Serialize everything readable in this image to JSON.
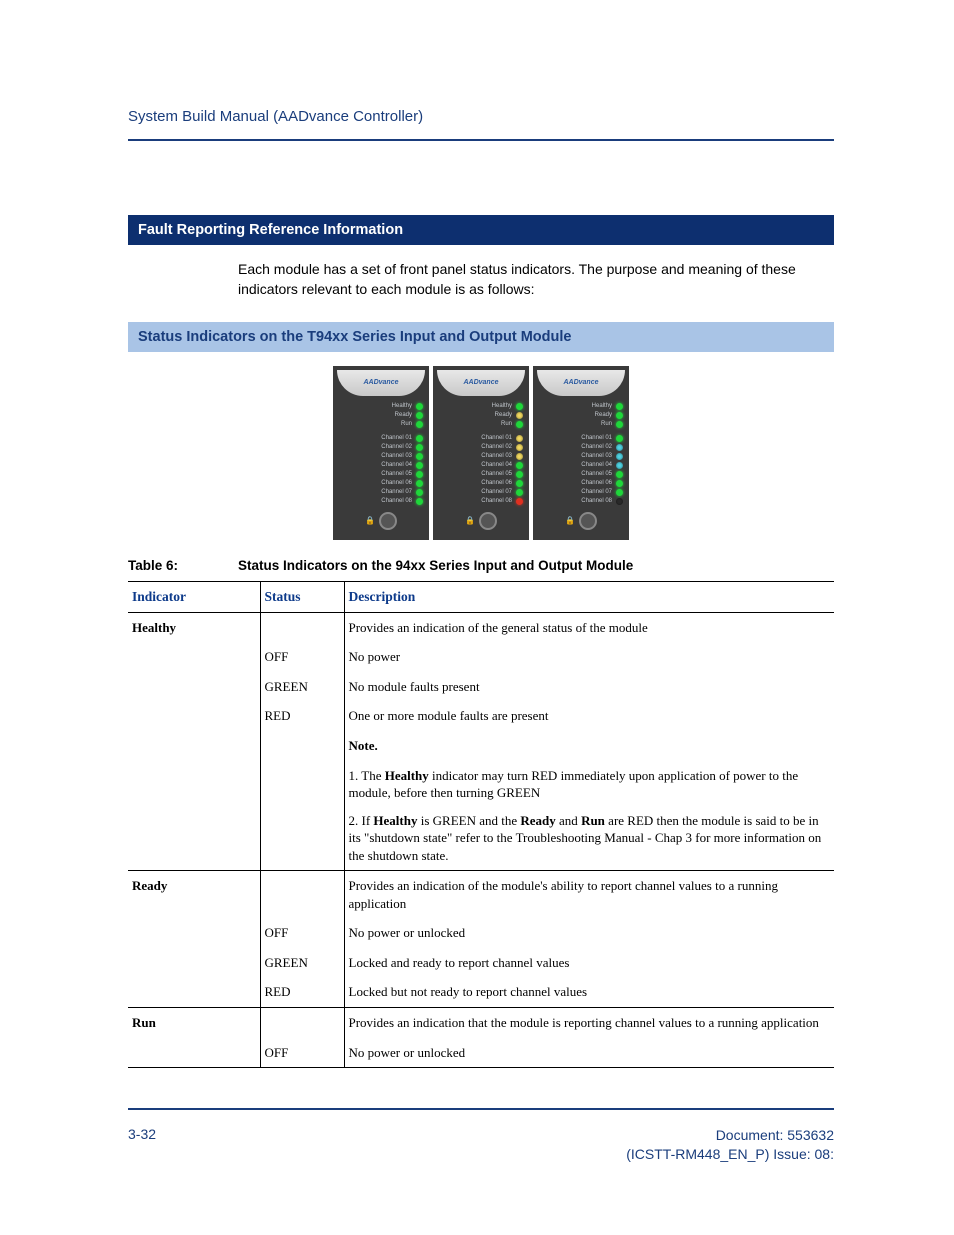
{
  "header": {
    "title": "System Build Manual  (AADvance Controller)"
  },
  "section1": {
    "title": "Fault Reporting Reference Information"
  },
  "intro": "Each module has a set of front panel status indicators. The purpose and meaning of these indicators relevant to each module is as follows:",
  "section2": {
    "title": "Status Indicators on the T94xx Series Input and Output Module"
  },
  "modules": {
    "brand": "AADvance",
    "status_labels": [
      "Healthy",
      "Ready",
      "Run"
    ],
    "channel_labels": [
      "Channel  01",
      "Channel  02",
      "Channel  03",
      "Channel  04",
      "Channel  05",
      "Channel  06",
      "Channel  07",
      "Channel  08"
    ],
    "units": [
      {
        "status_leds": [
          "green",
          "green",
          "green"
        ],
        "channel_leds": [
          "green",
          "green",
          "green",
          "green",
          "green",
          "green",
          "green",
          "green"
        ]
      },
      {
        "status_leds": [
          "green",
          "amber",
          "green"
        ],
        "channel_leds": [
          "amber",
          "amber",
          "amber",
          "green",
          "green",
          "green",
          "green",
          "red"
        ]
      },
      {
        "status_leds": [
          "green",
          "green",
          "green"
        ],
        "channel_leds": [
          "green",
          "cyan",
          "cyan",
          "cyan",
          "green",
          "green",
          "green",
          "dark"
        ]
      }
    ]
  },
  "table": {
    "caption_num": "Table 6:",
    "caption_text": "Status Indicators on the 94xx Series Input and Output Module",
    "headers": [
      "Indicator",
      "Status",
      "Description"
    ],
    "groups": [
      {
        "indicator": "Healthy",
        "heading_desc": "Provides an indication of the general status of the module",
        "rows": [
          {
            "status": "OFF",
            "desc": "No power"
          },
          {
            "status": "GREEN",
            "desc": "No module faults present"
          },
          {
            "status": "RED",
            "desc": "One or more module faults are present"
          }
        ],
        "note": {
          "title": "Note.",
          "p1_prefix": "1. The ",
          "p1_bold": "Healthy",
          "p1_suffix": " indicator may turn RED immediately upon application of power to the module, before then turning GREEN",
          "p2_prefix": " 2. If ",
          "p2_b1": "Healthy",
          "p2_mid1": " is GREEN and the ",
          "p2_b2": "Ready",
          "p2_mid2": " and ",
          "p2_b3": "Run",
          "p2_suffix": " are RED then the module is said to be in its \"shutdown state\" refer to the Troubleshooting Manual  - Chap 3 for more information on the shutdown state."
        }
      },
      {
        "indicator": "Ready",
        "heading_desc": "Provides an indication of the module's ability to report channel values to a running application",
        "rows": [
          {
            "status": "OFF",
            "desc": "No power or unlocked"
          },
          {
            "status": "GREEN",
            "desc": "Locked and ready to report channel values"
          },
          {
            "status": "RED",
            "desc": "Locked but not ready to report channel values"
          }
        ]
      },
      {
        "indicator": "Run",
        "heading_desc": "Provides an indication that the module is reporting channel values to a running application",
        "rows": [
          {
            "status": "OFF",
            "desc": "No power or unlocked"
          }
        ]
      }
    ]
  },
  "footer": {
    "page": "3-32",
    "doc_line1": "Document: 553632",
    "doc_line2": "(ICSTT-RM448_EN_P) Issue: 08:"
  }
}
